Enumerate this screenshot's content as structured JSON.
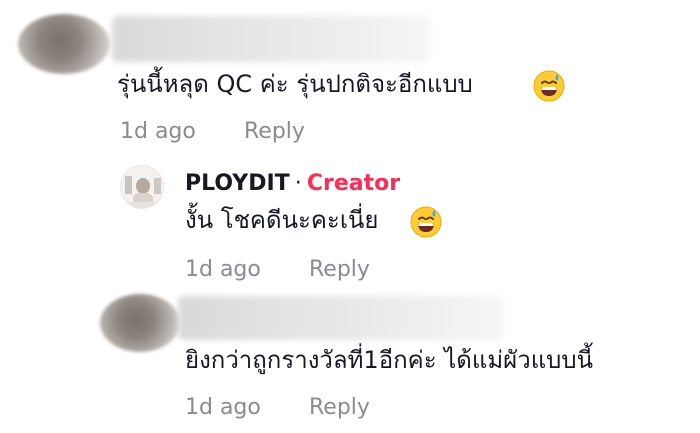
{
  "colors": {
    "text": "#161823",
    "meta": "#8a8b91",
    "creator_badge": "#fe2c55"
  },
  "comments": [
    {
      "text": "รุ่นนี้หลุด QC ค่ะ รุ่นปกติจะอีกแบบ",
      "emoji": "grinning-sweat-emoji",
      "time": "1d ago",
      "reply_label": "Reply"
    },
    {
      "username": "PLOYDIT",
      "separator": "·",
      "badge": "Creator",
      "text": "งั้น โชคดีนะคะเนี่ย",
      "emoji": "grinning-sweat-emoji",
      "time": "1d ago",
      "reply_label": "Reply"
    },
    {
      "text": "ยิงกว่าถูกรางวัลที่1อีกค่ะ ได้แม่ผัวแบบนี้",
      "time": "1d ago",
      "reply_label": "Reply"
    }
  ]
}
